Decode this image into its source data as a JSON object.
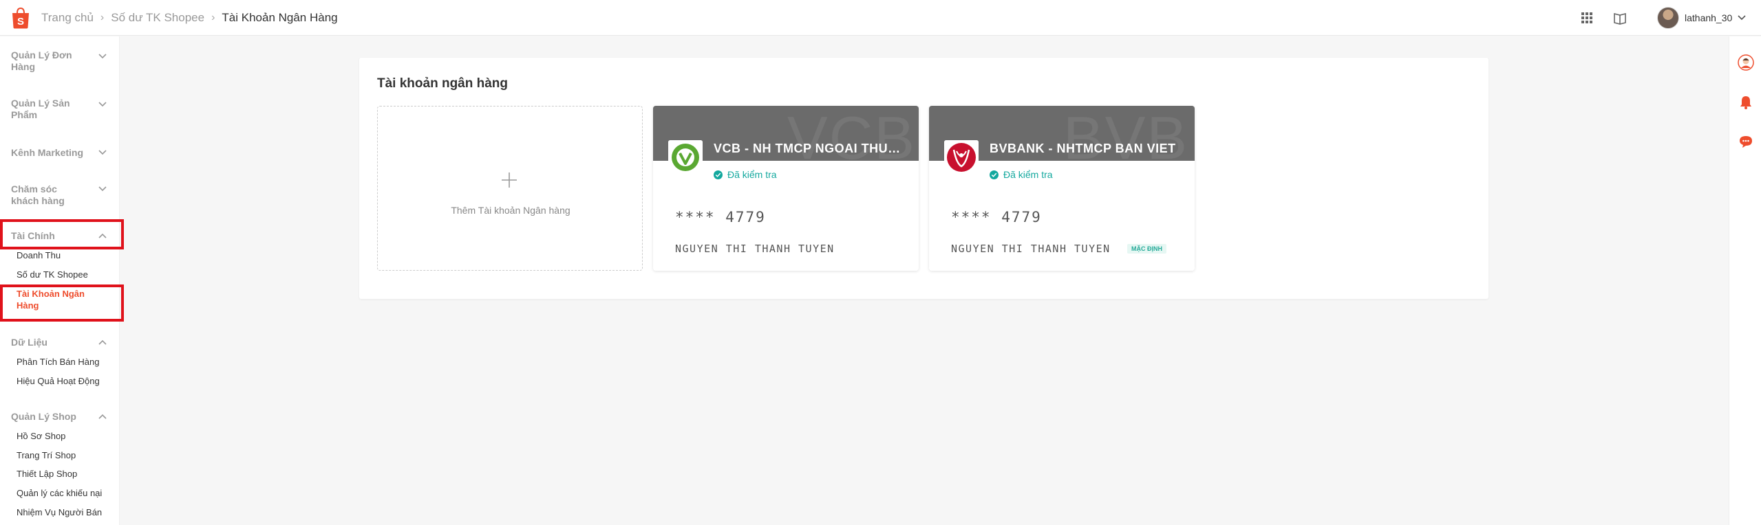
{
  "header": {
    "breadcrumb": [
      "Trang chủ",
      "Số dư TK Shopee",
      "Tài Khoản Ngân Hàng"
    ],
    "username": "lathanh_30"
  },
  "sidebar": {
    "sections": [
      {
        "title": "Quản Lý Đơn Hàng",
        "expanded": false,
        "items": []
      },
      {
        "title": "Quản Lý Sản Phẩm",
        "expanded": false,
        "items": []
      },
      {
        "title": "Kênh Marketing",
        "expanded": false,
        "items": []
      },
      {
        "title": "Chăm sóc khách hàng",
        "expanded": false,
        "items": []
      },
      {
        "title": "Tài Chính",
        "expanded": true,
        "items": [
          "Doanh Thu",
          "Số dư TK Shopee",
          "Tài Khoản Ngân Hàng"
        ]
      },
      {
        "title": "Dữ Liệu",
        "expanded": true,
        "items": [
          "Phân Tích Bán Hàng",
          "Hiệu Quả Hoạt Động"
        ]
      },
      {
        "title": "Quản Lý Shop",
        "expanded": true,
        "items": [
          "Hồ Sơ Shop",
          "Trang Trí Shop",
          "Thiết Lập Shop",
          "Quản lý các khiếu nại",
          "Nhiệm Vụ Người Bán"
        ]
      }
    ],
    "active_item": "Tài Khoản Ngân Hàng"
  },
  "main": {
    "title": "Tài khoản ngân hàng",
    "add_label": "Thêm Tài khoản Ngân hàng",
    "banks": [
      {
        "watermark": "VCB",
        "name": "VCB - NH TMCP NGOAI THUONG VIET NAM",
        "status": "Đã kiểm tra",
        "account": "**** 4779",
        "holder": "NGUYEN THI THANH TUYEN",
        "badge": ""
      },
      {
        "watermark": "BVB",
        "name": "BVBANK - NHTMCP BAN VIET",
        "status": "Đã kiểm tra",
        "account": "**** 4779",
        "holder": "NGUYEN THI THANH TUYEN",
        "badge": "MẶC ĐỊNH"
      }
    ]
  },
  "colors": {
    "brand": "#ee4d2d",
    "highlight": "#e0121b",
    "verified": "#13a89e",
    "card_header": "#6b6b6b"
  }
}
